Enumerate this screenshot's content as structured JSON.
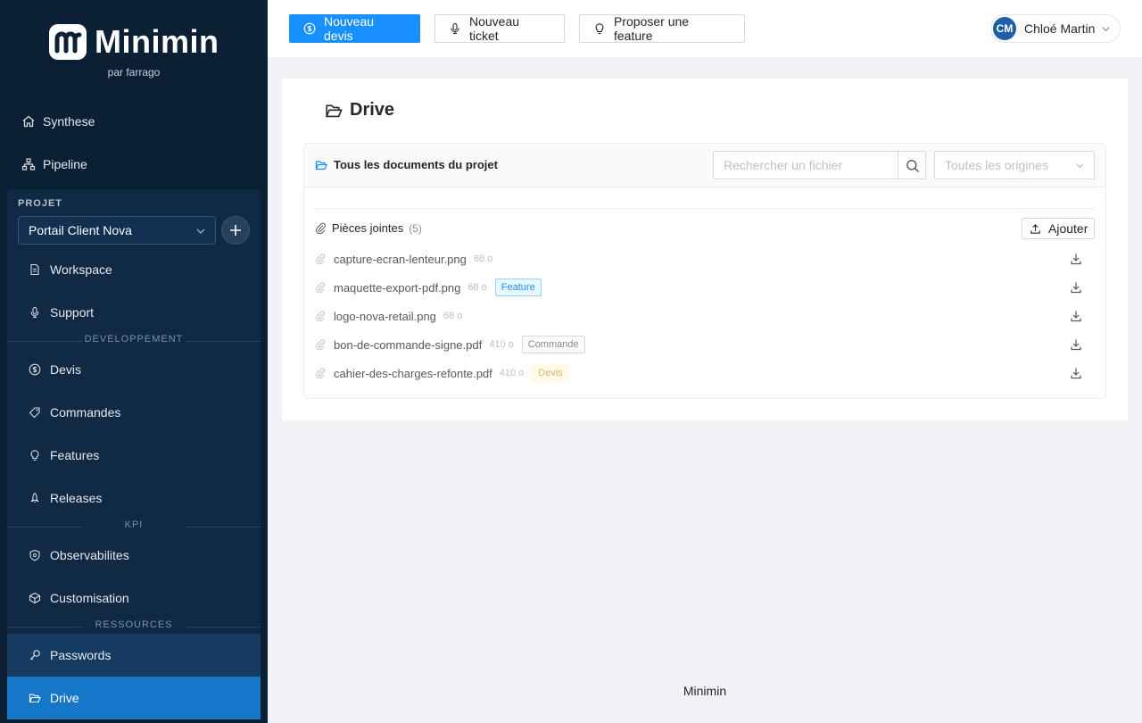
{
  "brand": {
    "name": "Minimin",
    "subtitle": "par farrago"
  },
  "nav": [
    {
      "label": "Synthese",
      "icon": "home-icon"
    },
    {
      "label": "Pipeline",
      "icon": "sitemap-icon"
    }
  ],
  "project": {
    "label": "PROJET",
    "selected": "Portail Client Nova",
    "items_main": [
      {
        "label": "Workspace",
        "icon": "file-icon"
      },
      {
        "label": "Support",
        "icon": "microphone-icon"
      }
    ],
    "section_dev": "DEVELOPPEMENT",
    "items_dev": [
      {
        "label": "Devis",
        "icon": "dollar-icon"
      },
      {
        "label": "Commandes",
        "icon": "tag-icon"
      },
      {
        "label": "Features",
        "icon": "bulb-icon"
      },
      {
        "label": "Releases",
        "icon": "rocket-icon"
      }
    ],
    "section_kpi": "KPI",
    "items_kpi": [
      {
        "label": "Observabilites",
        "icon": "shield-icon"
      },
      {
        "label": "Customisation",
        "icon": "cube-icon"
      }
    ],
    "section_res": "RESSOURCES",
    "items_res": [
      {
        "label": "Passwords",
        "icon": "key-icon"
      },
      {
        "label": "Drive",
        "icon": "folder-open-icon"
      }
    ]
  },
  "header": {
    "new_quote": "Nouveau devis",
    "new_ticket": "Nouveau ticket",
    "suggest_feature": "Proposer une feature",
    "user_initials": "CM",
    "user_name": "Chloé Martin"
  },
  "page": {
    "title": "Drive",
    "card_title": "Tous les documents du projet",
    "search_placeholder": "Rechercher un fichier",
    "origin_placeholder": "Toutes les origines",
    "attachments_label": "Pièces jointes",
    "attachments_count": "(5)",
    "add_label": "Ajouter",
    "files": [
      {
        "name": "capture-ecran-lenteur.png",
        "size": "68 o",
        "tag": ""
      },
      {
        "name": "maquette-export-pdf.png",
        "size": "68 o",
        "tag": "Feature"
      },
      {
        "name": "logo-nova-retail.png",
        "size": "68 o",
        "tag": ""
      },
      {
        "name": "bon-de-commande-signe.pdf",
        "size": "410 o",
        "tag": "Commande"
      },
      {
        "name": "cahier-des-charges-refonte.pdf",
        "size": "410 o",
        "tag": "Devis"
      }
    ]
  },
  "footer": {
    "text": "Minimin"
  },
  "colors": {
    "sidebar": "#0b1f35",
    "primary": "#1890ff",
    "active": "#1677c8"
  }
}
